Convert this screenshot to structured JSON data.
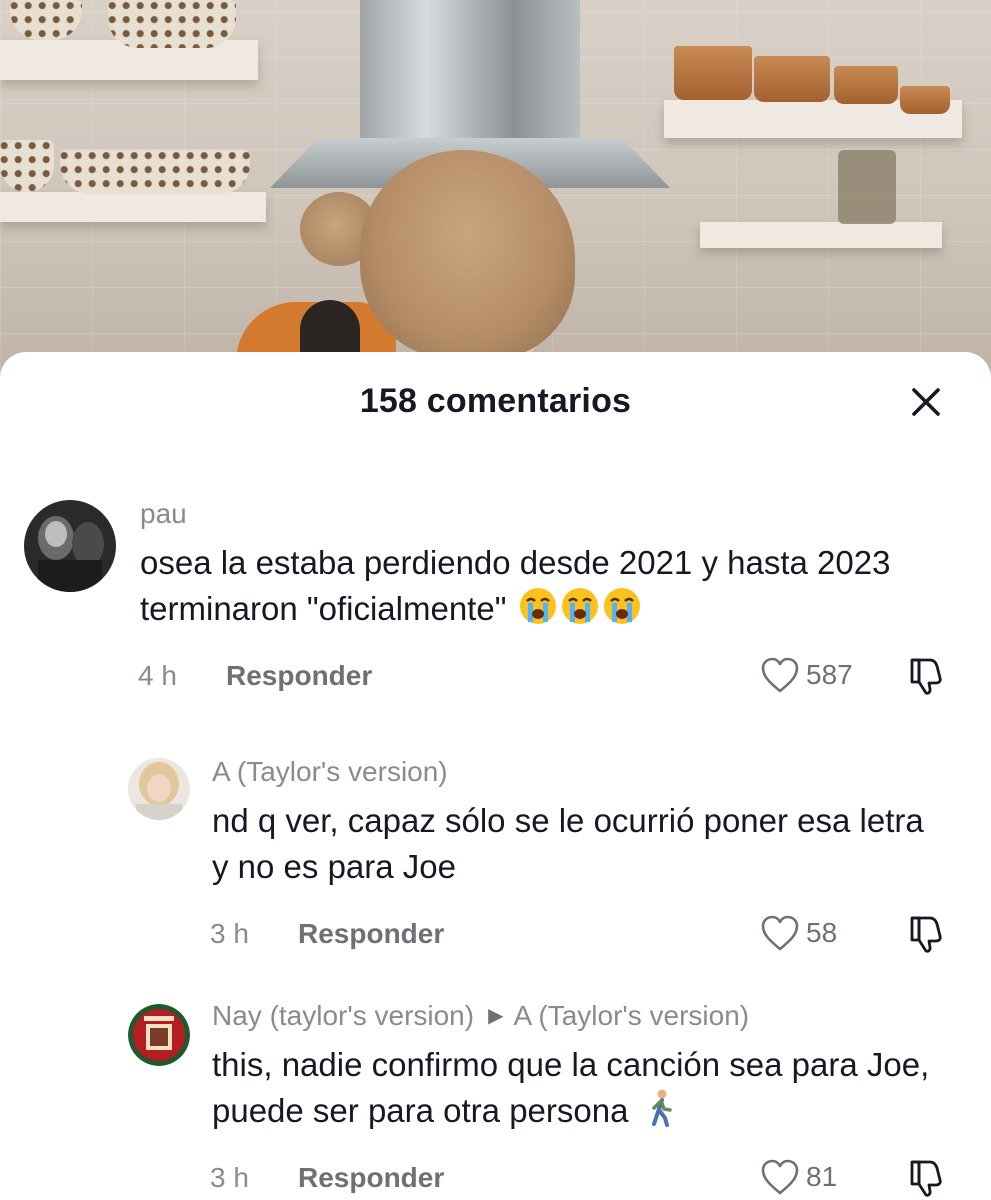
{
  "sheet": {
    "title": "158 comentarios",
    "close_icon": "close-icon"
  },
  "comments": [
    {
      "username": "pau",
      "text": "osea la estaba perdiendo desde 2021 y hasta 2023 terminaron \"oficialmente\"",
      "emoji": [
        "loudly-crying-face",
        "loudly-crying-face",
        "loudly-crying-face"
      ],
      "time": "4 h",
      "reply_label": "Responder",
      "likes": "587"
    },
    {
      "username": "A (Taylor's version)",
      "text": "nd q ver, capaz sólo se le ocurrió poner esa letra y no es para Joe",
      "time": "3 h",
      "reply_label": "Responder",
      "likes": "58"
    },
    {
      "username": "Nay (taylor's version)",
      "reply_to": "A (Taylor's version)",
      "text": "this, nadie confirmo que la canción sea para Joe, puede ser para otra persona",
      "emoji": [
        "person-walking"
      ],
      "time": "3 h",
      "reply_label": "Responder",
      "likes": "81"
    }
  ],
  "colors": {
    "text_primary": "#161823",
    "text_secondary": "#8a8b91",
    "sheet_bg": "#ffffff"
  }
}
